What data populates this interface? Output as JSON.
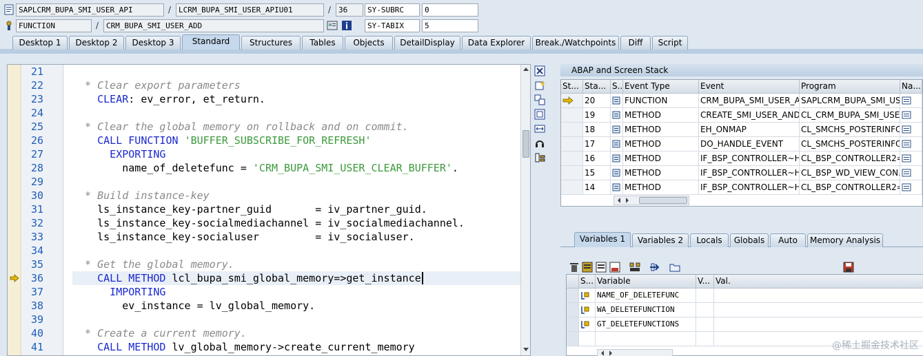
{
  "header": {
    "row1": {
      "program": "SAPLCRM_BUPA_SMI_USER_API",
      "include": "LCRM_BUPA_SMI_USER_APIU01",
      "line": "36",
      "sysfield_label": "SY-SUBRC",
      "sysfield_value": "0"
    },
    "row2": {
      "event_type": "FUNCTION",
      "event": "CRM_BUPA_SMI_USER_ADD",
      "sysfield_label": "SY-TABIX",
      "sysfield_value": "5"
    },
    "slash": "/"
  },
  "tabs": [
    "Desktop 1",
    "Desktop 2",
    "Desktop 3",
    "Standard",
    "Structures",
    "Tables",
    "Objects",
    "DetailDisplay",
    "Data Explorer",
    "Break./Watchpoints",
    "Diff",
    "Script"
  ],
  "active_tab": "Standard",
  "editor": {
    "current_line": "36",
    "lines": [
      {
        "n": "21",
        "code": []
      },
      {
        "n": "22",
        "code": [
          {
            "t": "  * Clear export parameters",
            "c": "cm"
          }
        ]
      },
      {
        "n": "23",
        "code": [
          {
            "t": "    CLEAR",
            "c": "kw"
          },
          {
            "t": ": ev_error, et_return.",
            "c": ""
          }
        ]
      },
      {
        "n": "24",
        "code": []
      },
      {
        "n": "25",
        "code": [
          {
            "t": "  * Clear the global memory on rollback and on commit.",
            "c": "cm"
          }
        ]
      },
      {
        "n": "26",
        "code": [
          {
            "t": "    CALL FUNCTION ",
            "c": "kw"
          },
          {
            "t": "'BUFFER_SUBSCRIBE_FOR_REFRESH'",
            "c": "st"
          }
        ]
      },
      {
        "n": "27",
        "code": [
          {
            "t": "      EXPORTING",
            "c": "kw"
          }
        ]
      },
      {
        "n": "28",
        "code": [
          {
            "t": "        name_of_deletefunc = ",
            "c": ""
          },
          {
            "t": "'CRM_BUPA_SMI_USER_CLEAR_BUFFER'",
            "c": "st"
          },
          {
            "t": ".",
            "c": ""
          }
        ]
      },
      {
        "n": "29",
        "code": []
      },
      {
        "n": "30",
        "code": [
          {
            "t": "  * Build instance-key",
            "c": "cm"
          }
        ]
      },
      {
        "n": "31",
        "code": [
          {
            "t": "    ls_instance_key-partner_guid       = iv_partner_guid.",
            "c": ""
          }
        ]
      },
      {
        "n": "32",
        "code": [
          {
            "t": "    ls_instance_key-socialmediachannel = iv_socialmediachannel.",
            "c": ""
          }
        ]
      },
      {
        "n": "33",
        "code": [
          {
            "t": "    ls_instance_key-socialuser         = iv_socialuser.",
            "c": ""
          }
        ]
      },
      {
        "n": "34",
        "code": []
      },
      {
        "n": "35",
        "code": [
          {
            "t": "  * Get the global memory.",
            "c": "cm"
          }
        ]
      },
      {
        "n": "36",
        "code": [
          {
            "t": "    CALL METHOD ",
            "c": "kw"
          },
          {
            "t": "lcl_bupa_smi_global_memory=>get_instance",
            "c": ""
          }
        ]
      },
      {
        "n": "37",
        "code": [
          {
            "t": "      IMPORTING",
            "c": "kw"
          }
        ]
      },
      {
        "n": "38",
        "code": [
          {
            "t": "        ev_instance = lv_global_memory.",
            "c": ""
          }
        ]
      },
      {
        "n": "39",
        "code": []
      },
      {
        "n": "40",
        "code": [
          {
            "t": "  * Create a current memory.",
            "c": "cm"
          }
        ]
      },
      {
        "n": "41",
        "code": [
          {
            "t": "    CALL METHOD ",
            "c": "kw"
          },
          {
            "t": "lv_global_memory->create_current_memory",
            "c": ""
          }
        ]
      }
    ]
  },
  "stack": {
    "title": "ABAP and Screen Stack",
    "columns": [
      "St...",
      "Sta...",
      "S...",
      "Event Type",
      "Event",
      "Program",
      "Na..."
    ],
    "rows": [
      {
        "current": true,
        "level": "20",
        "type": "FUNCTION",
        "event": "CRM_BUPA_SMI_USER_A...",
        "program": "SAPLCRM_BUPA_SMI_US..."
      },
      {
        "current": false,
        "level": "19",
        "type": "METHOD",
        "event": "CREATE_SMI_USER_AND...",
        "program": "CL_CRM_BUPA_SMI_USE..."
      },
      {
        "current": false,
        "level": "18",
        "type": "METHOD",
        "event": "EH_ONMAP",
        "program": "CL_SMCHS_POSTERINFO..."
      },
      {
        "current": false,
        "level": "17",
        "type": "METHOD",
        "event": "DO_HANDLE_EVENT",
        "program": "CL_SMCHS_POSTERINFO..."
      },
      {
        "current": false,
        "level": "16",
        "type": "METHOD",
        "event": "IF_BSP_CONTROLLER~H...",
        "program": "CL_BSP_CONTROLLER2=..."
      },
      {
        "current": false,
        "level": "15",
        "type": "METHOD",
        "event": "IF_BSP_CONTROLLER~H...",
        "program": "CL_BSP_WD_VIEW_CON..."
      },
      {
        "current": false,
        "level": "14",
        "type": "METHOD",
        "event": "IF_BSP_CONTROLLER~H...",
        "program": "CL_BSP_CONTROLLER2=..."
      }
    ]
  },
  "var_tabs": [
    "Variables 1",
    "Variables 2",
    "Locals",
    "Globals",
    "Auto",
    "Memory Analysis"
  ],
  "active_var_tab": "Variables 1",
  "variables": {
    "columns": [
      "S...",
      "Variable",
      "V...",
      "Val."
    ],
    "rows": [
      "NAME_OF_DELETEFUNC",
      "WA_DELETEFUNCTION",
      "GT_DELETEFUNCTIONS"
    ]
  },
  "watermark": "@稀土掘金技术社区",
  "colors": {
    "keyword": "#1a29cf",
    "comment": "#8a8a8a",
    "string": "#3c9a3c",
    "line_number": "#1f5cb5"
  }
}
